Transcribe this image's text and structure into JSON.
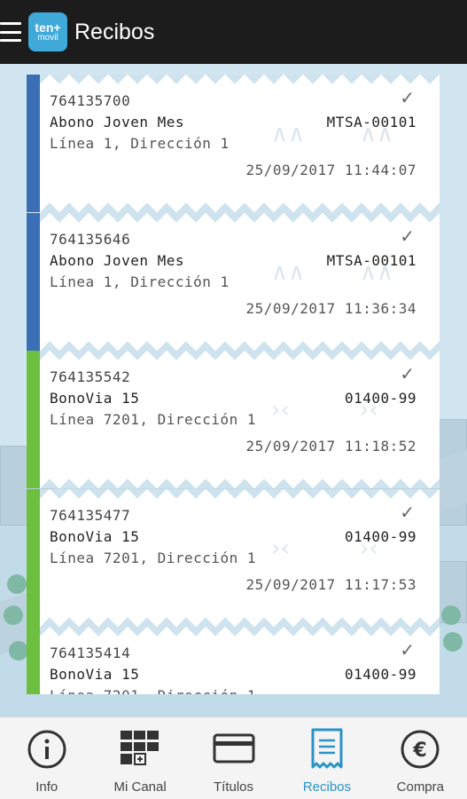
{
  "app": {
    "title": "Recibos",
    "logo_top": "ten+",
    "logo_bottom": "movil"
  },
  "receipts": [
    {
      "number": "764135700",
      "name": "Abono Joven Mes",
      "code": "MTSA-00101",
      "route": "Línea 1, Dirección 1",
      "datetime": "25/09/2017 11:44:07",
      "stripe_color": "#3a6fb5"
    },
    {
      "number": "764135646",
      "name": "Abono Joven Mes",
      "code": "MTSA-00101",
      "route": "Línea 1, Dirección 1",
      "datetime": "25/09/2017 11:36:34",
      "stripe_color": "#3a6fb5"
    },
    {
      "number": "764135542",
      "name": "BonoVia 15",
      "code": "01400-99",
      "route": "Línea 7201, Dirección 1",
      "datetime": "25/09/2017 11:18:52",
      "stripe_color": "#6cbf3f"
    },
    {
      "number": "764135477",
      "name": "BonoVia 15",
      "code": "01400-99",
      "route": "Línea 7201, Dirección 1",
      "datetime": "25/09/2017 11:17:53",
      "stripe_color": "#6cbf3f"
    },
    {
      "number": "764135414",
      "name": "BonoVia 15",
      "code": "01400-99",
      "route": "Línea 7201, Dirección 1",
      "datetime": "",
      "stripe_color": "#6cbf3f"
    }
  ],
  "nav": {
    "info": "Info",
    "mi_canal": "Mi Canal",
    "titulos": "Títulos",
    "recibos": "Recibos",
    "compra": "Compra"
  },
  "colors": {
    "accent": "#2a93c6",
    "appbar": "#1c1c1c"
  }
}
